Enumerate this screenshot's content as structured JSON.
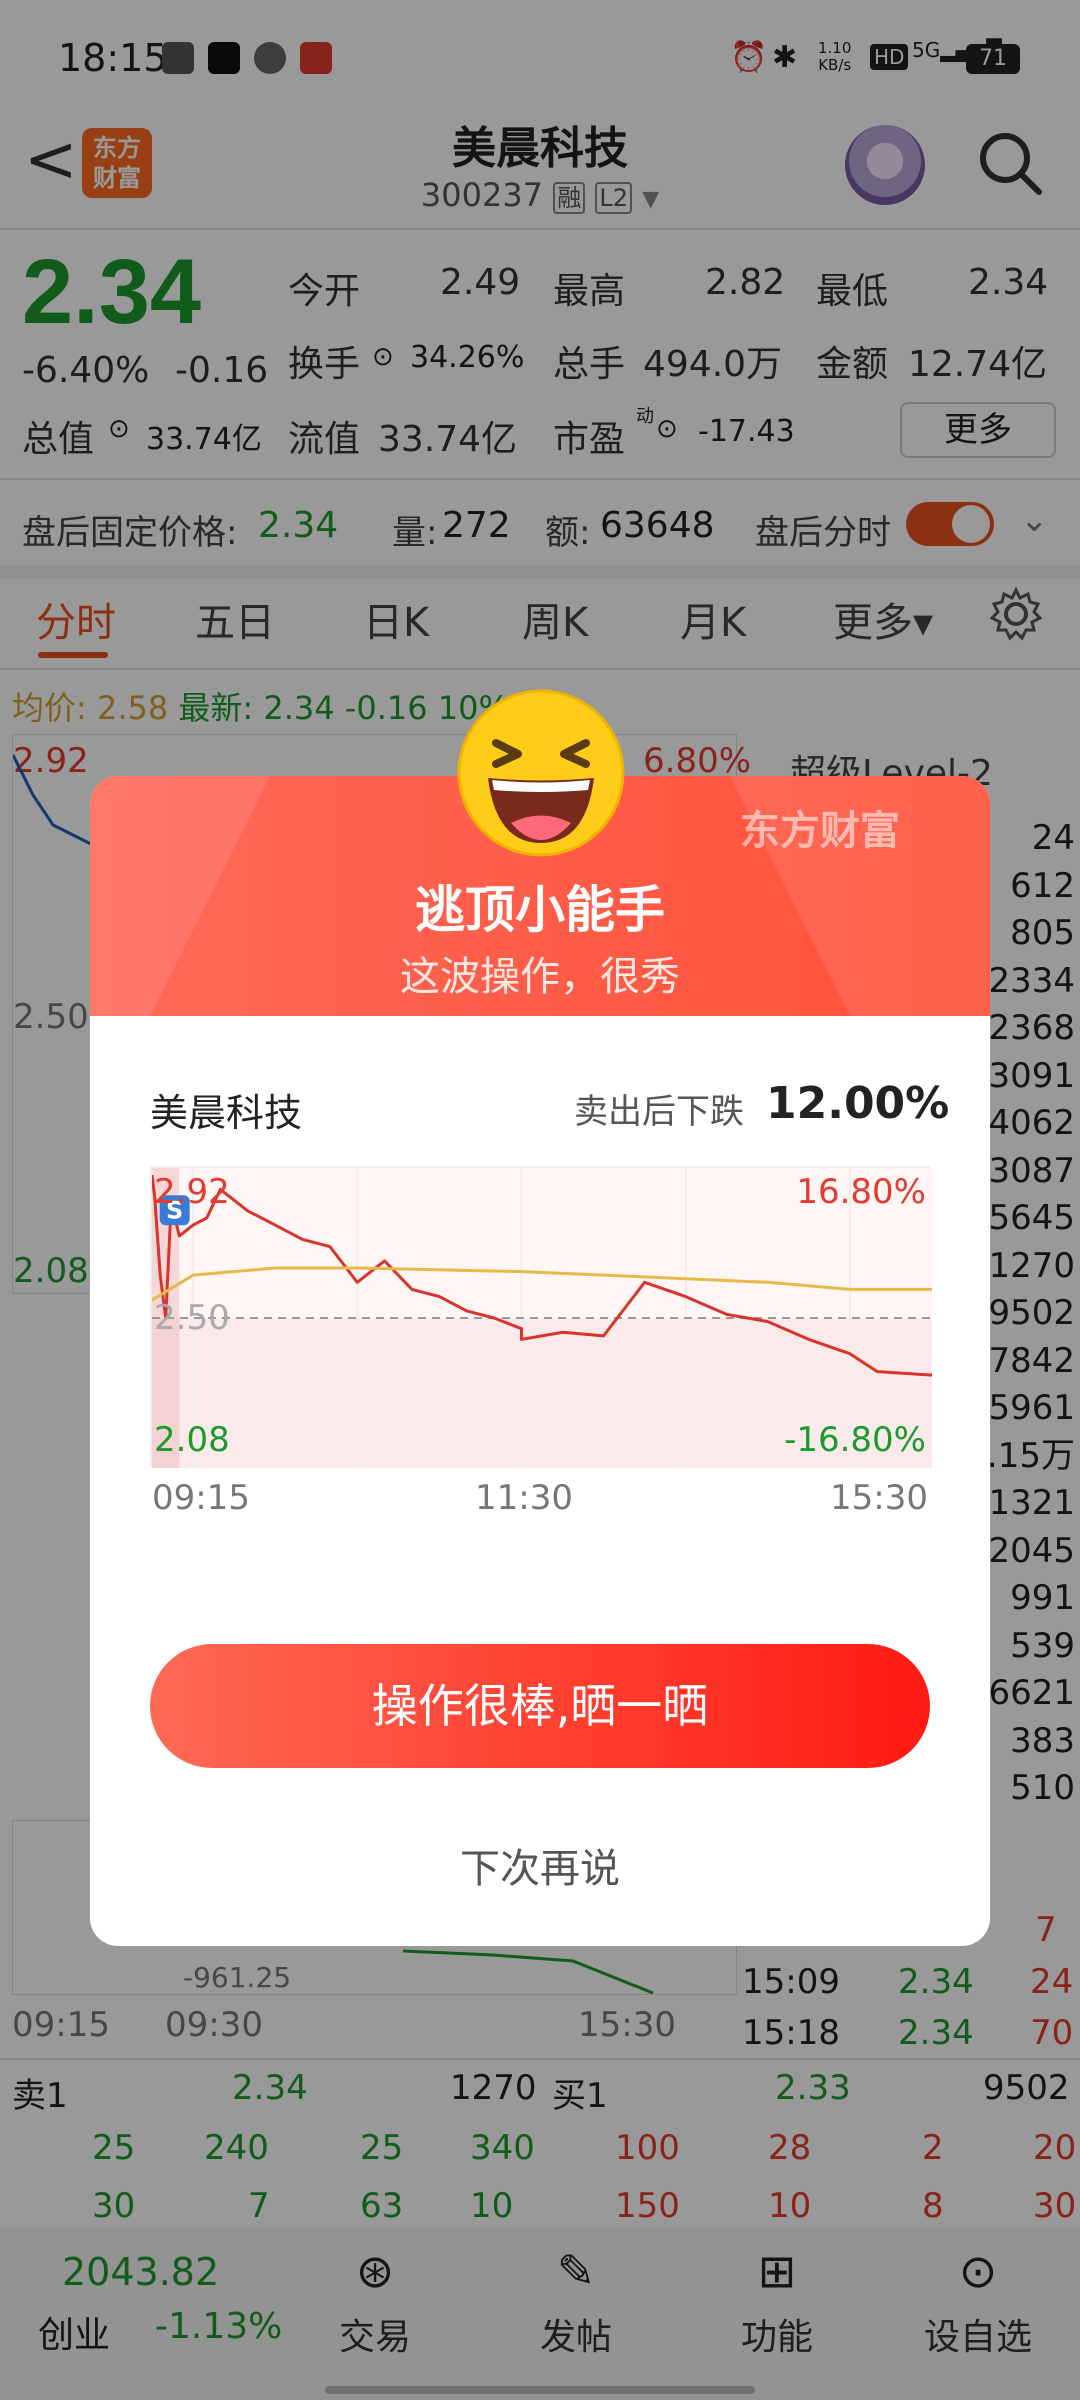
{
  "status_bar": {
    "time": "18:15",
    "net_speed_top": "1.10",
    "net_speed_bottom": "KB/s",
    "hd": "HD",
    "signal": "5G",
    "battery": "71"
  },
  "header": {
    "back": "<",
    "logo_text_top": "东方",
    "logo_text_bottom": "财富",
    "stock_name": "美晨科技",
    "stock_code": "300237",
    "tag_rong": "融",
    "tag_l2": "L2"
  },
  "quote": {
    "price": "2.34",
    "change_pct": "-6.40%",
    "change": "-0.16",
    "open_label": "今开",
    "open": "2.49",
    "high_label": "最高",
    "high": "2.82",
    "low_label": "最低",
    "low": "2.34",
    "turnover_label": "换手",
    "turnover": "34.26%",
    "volume_label": "总手",
    "volume": "494.0万",
    "amount_label": "金额",
    "amount": "12.74亿",
    "mktcap_label": "总值",
    "mktcap": "33.74亿",
    "float_label": "流值",
    "float": "33.74亿",
    "pe_label": "市盈",
    "pe_sup": "动",
    "pe": "-17.43",
    "more": "更多"
  },
  "after_hours": {
    "label": "盘后固定价格:",
    "price": "2.34",
    "vol_label": "量:",
    "vol": "272",
    "amt_label": "额:",
    "amt": "63648",
    "toggle_label": "盘后分时"
  },
  "tabs": [
    "分时",
    "五日",
    "日K",
    "周K",
    "月K",
    "更多▾"
  ],
  "chart_header": {
    "avg_label": "均价:",
    "avg": "2.58",
    "last_label": "最新:",
    "last": "2.34",
    "chg": "-0.16",
    "pct": "10%"
  },
  "background_chart": {
    "y_top": "2.92",
    "y_mid": "2.50",
    "y_low": "2.08",
    "pct_top": "6.80%",
    "l2_label": "超级Level-2",
    "x_labels": [
      "09:15",
      "09:30",
      "15:30"
    ],
    "volume_label": "-961.25",
    "right_column": [
      "24",
      "612",
      "805",
      "2334",
      "2368",
      "3091",
      "4062",
      "3087",
      "5645",
      "1270",
      "9502",
      "7842",
      "5961",
      ".15万",
      "1321",
      "2045",
      "991",
      "539",
      "6621",
      "383",
      "510"
    ],
    "trades": [
      {
        "time": "",
        "price": "",
        "vol": "7"
      },
      {
        "time": "15:09",
        "price": "2.34",
        "vol": "24"
      },
      {
        "time": "15:18",
        "price": "2.34",
        "vol": "70"
      }
    ]
  },
  "order_book": {
    "sell1_label": "卖1",
    "sell1_price": "2.34",
    "sell1_vol": "1270",
    "buy1_label": "买1",
    "buy1_price": "2.33",
    "buy1_vol": "9502",
    "sell_rows": [
      [
        "25",
        "240",
        "25",
        "340"
      ],
      [
        "30",
        "7",
        "63",
        "10"
      ]
    ],
    "buy_rows": [
      [
        "100",
        "28",
        "2",
        "20"
      ],
      [
        "150",
        "10",
        "8",
        "30"
      ]
    ]
  },
  "modal": {
    "brand": "东方财富",
    "title": "逃顶小能手",
    "subtitle": "这波操作，很秀",
    "stock_name": "美晨科技",
    "drop_label": "卖出后下跌",
    "drop_value": "12.00%",
    "share_button": "操作很棒,晒一晒",
    "later_button": "下次再说"
  },
  "chart_data": {
    "type": "line",
    "title": "",
    "x_ticks": [
      "09:15",
      "11:30",
      "15:30"
    ],
    "y_left_ticks": [
      "2.92",
      "2.50",
      "2.08"
    ],
    "y_right_ticks": [
      "16.80%",
      "-16.80%"
    ],
    "ylim": [
      2.08,
      2.92
    ],
    "reference_price": 2.5,
    "sell_marker": {
      "label": "S",
      "x": "09:20",
      "y": 2.81
    },
    "series": [
      {
        "color": "#d9342b",
        "points": [
          [
            "09:15",
            2.9
          ],
          [
            "09:16",
            2.84
          ],
          [
            "09:18",
            2.62
          ],
          [
            "09:20",
            2.5
          ],
          [
            "09:22",
            2.82
          ],
          [
            "09:25",
            2.73
          ],
          [
            "09:30",
            2.76
          ],
          [
            "09:35",
            2.78
          ],
          [
            "09:40",
            2.86
          ],
          [
            "09:50",
            2.8
          ],
          [
            "10:00",
            2.76
          ],
          [
            "10:10",
            2.72
          ],
          [
            "10:20",
            2.7
          ],
          [
            "10:30",
            2.6
          ],
          [
            "10:40",
            2.66
          ],
          [
            "10:50",
            2.58
          ],
          [
            "11:00",
            2.56
          ],
          [
            "11:10",
            2.52
          ],
          [
            "11:20",
            2.5
          ],
          [
            "11:30",
            2.47
          ],
          [
            "13:00",
            2.44
          ],
          [
            "13:15",
            2.46
          ],
          [
            "13:30",
            2.45
          ],
          [
            "13:45",
            2.6
          ],
          [
            "14:00",
            2.56
          ],
          [
            "14:15",
            2.51
          ],
          [
            "14:30",
            2.49
          ],
          [
            "14:45",
            2.44
          ],
          [
            "15:00",
            2.4
          ],
          [
            "15:10",
            2.35
          ],
          [
            "15:30",
            2.34
          ]
        ]
      },
      {
        "color": "#e8b84a",
        "points": [
          [
            "09:15",
            2.55
          ],
          [
            "09:30",
            2.62
          ],
          [
            "10:00",
            2.64
          ],
          [
            "10:30",
            2.64
          ],
          [
            "11:30",
            2.63
          ],
          [
            "13:30",
            2.62
          ],
          [
            "14:30",
            2.6
          ],
          [
            "15:00",
            2.58
          ],
          [
            "15:30",
            2.58
          ]
        ]
      }
    ]
  },
  "bottom_nav": {
    "index_value": "2043.82",
    "index_name": "创业",
    "index_pct": "-1.13%",
    "items": [
      "交易",
      "发帖",
      "功能",
      "设自选"
    ]
  }
}
